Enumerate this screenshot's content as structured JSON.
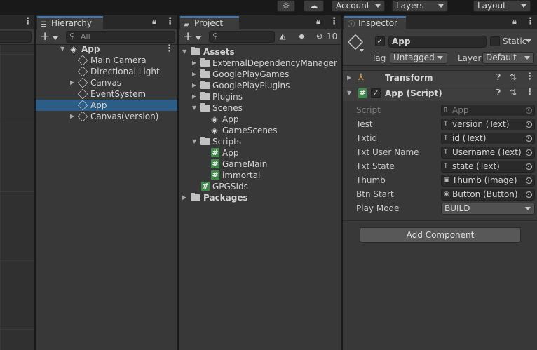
{
  "toolbar": {
    "account_label": "Account",
    "layers_label": "Layers",
    "layout_label": "Layout",
    "icons": [
      "sun-icon",
      "cloud-icon"
    ]
  },
  "hierarchy": {
    "tab_label": "Hierarchy",
    "search_placeholder": "All",
    "items": [
      {
        "label": "App",
        "depth": 0,
        "icon": "unity-icon",
        "expanded": true,
        "selected": false
      },
      {
        "label": "Main Camera",
        "depth": 1,
        "icon": "cube-icon"
      },
      {
        "label": "Directional Light",
        "depth": 1,
        "icon": "cube-icon"
      },
      {
        "label": "Canvas",
        "depth": 1,
        "icon": "cube-icon",
        "collapsed": true
      },
      {
        "label": "EventSystem",
        "depth": 1,
        "icon": "cube-icon"
      },
      {
        "label": "App",
        "depth": 1,
        "icon": "cube-icon",
        "selected": true
      },
      {
        "label": "Canvas(version)",
        "depth": 1,
        "icon": "cube-icon",
        "collapsed": true
      }
    ]
  },
  "project": {
    "tab_label": "Project",
    "hidden_count": "10",
    "tree": [
      {
        "label": "Assets",
        "depth": 0,
        "icon": "folder-icon",
        "expanded": true,
        "bold": true
      },
      {
        "label": "ExternalDependencyManager",
        "depth": 1,
        "icon": "folder-icon",
        "collapsed": true
      },
      {
        "label": "GooglePlayGames",
        "depth": 1,
        "icon": "folder-icon",
        "collapsed": true
      },
      {
        "label": "GooglePlayPlugins",
        "depth": 1,
        "icon": "folder-icon",
        "collapsed": true
      },
      {
        "label": "Plugins",
        "depth": 1,
        "icon": "folder-icon",
        "collapsed": true
      },
      {
        "label": "Scenes",
        "depth": 1,
        "icon": "folder-icon",
        "expanded": true
      },
      {
        "label": "App",
        "depth": 2,
        "icon": "unity-icon"
      },
      {
        "label": "GameScenes",
        "depth": 2,
        "icon": "unity-icon"
      },
      {
        "label": "Scripts",
        "depth": 1,
        "icon": "folder-icon",
        "expanded": true
      },
      {
        "label": "App",
        "depth": 2,
        "icon": "script-icon"
      },
      {
        "label": "GameMain",
        "depth": 2,
        "icon": "script-icon"
      },
      {
        "label": "immortal",
        "depth": 2,
        "icon": "script-icon"
      },
      {
        "label": "GPGSIds",
        "depth": 1,
        "icon": "script-icon"
      },
      {
        "label": "Packages",
        "depth": 0,
        "icon": "folder-icon",
        "collapsed": true,
        "bold": true
      }
    ]
  },
  "inspector": {
    "tab_label": "Inspector",
    "object_name": "App",
    "static_label": "Static",
    "tag_label": "Tag",
    "tag_value": "Untagged",
    "layer_label": "Layer",
    "layer_value": "Default",
    "transform_title": "Transform",
    "script_component_title": "App (Script)",
    "properties": [
      {
        "label": "Script",
        "value": "App",
        "icon": "script-file-icon",
        "disabled": true
      },
      {
        "label": "Test",
        "value": "version (Text)",
        "icon": "text-icon"
      },
      {
        "label": "Txtid",
        "value": "id (Text)",
        "icon": "text-icon"
      },
      {
        "label": "Txt User Name",
        "value": "Username (Text)",
        "icon": "text-icon"
      },
      {
        "label": "Txt State",
        "value": "state (Text)",
        "icon": "text-icon"
      },
      {
        "label": "Thumb",
        "value": "Thumb (Image)",
        "icon": "image-icon"
      },
      {
        "label": "Btn Start",
        "value": "Button (Button)",
        "icon": "button-icon"
      }
    ],
    "play_mode_label": "Play Mode",
    "play_mode_value": "BUILD",
    "add_component_label": "Add Component"
  }
}
